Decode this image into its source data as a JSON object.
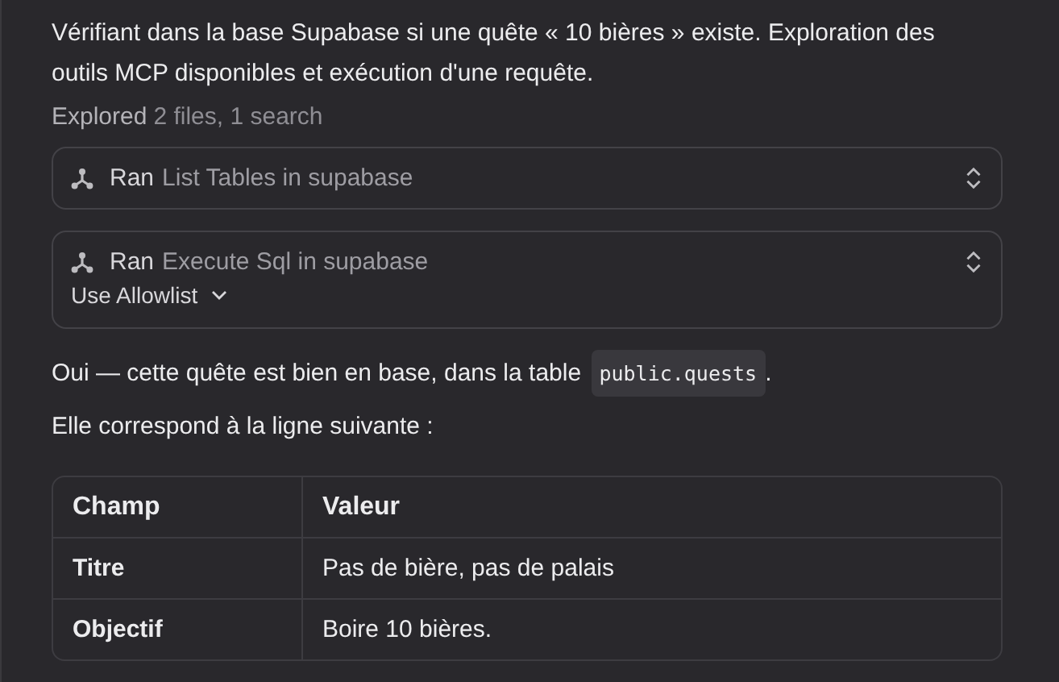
{
  "intro": "Vérifiant dans la base Supabase si une quête « 10 bières » existe. Exploration des outils MCP disponibles et exécution d'une requête.",
  "explored": {
    "label": "Explored",
    "summary": "2 files, 1 search"
  },
  "tool_calls": [
    {
      "verb": "Ran",
      "name": "List Tables in supabase"
    },
    {
      "verb": "Ran",
      "name": "Execute Sql in supabase",
      "option": "Use Allowlist"
    }
  ],
  "answer": {
    "before": "Oui — cette quête est bien en base, dans la table ",
    "code": "public.quests",
    "after": "."
  },
  "lead": "Elle correspond à la ligne suivante :",
  "table": {
    "columns": [
      "Champ",
      "Valeur"
    ],
    "rows": [
      [
        "Titre",
        "Pas de bière, pas de palais"
      ],
      [
        "Objectif",
        "Boire 10 bières."
      ]
    ]
  }
}
